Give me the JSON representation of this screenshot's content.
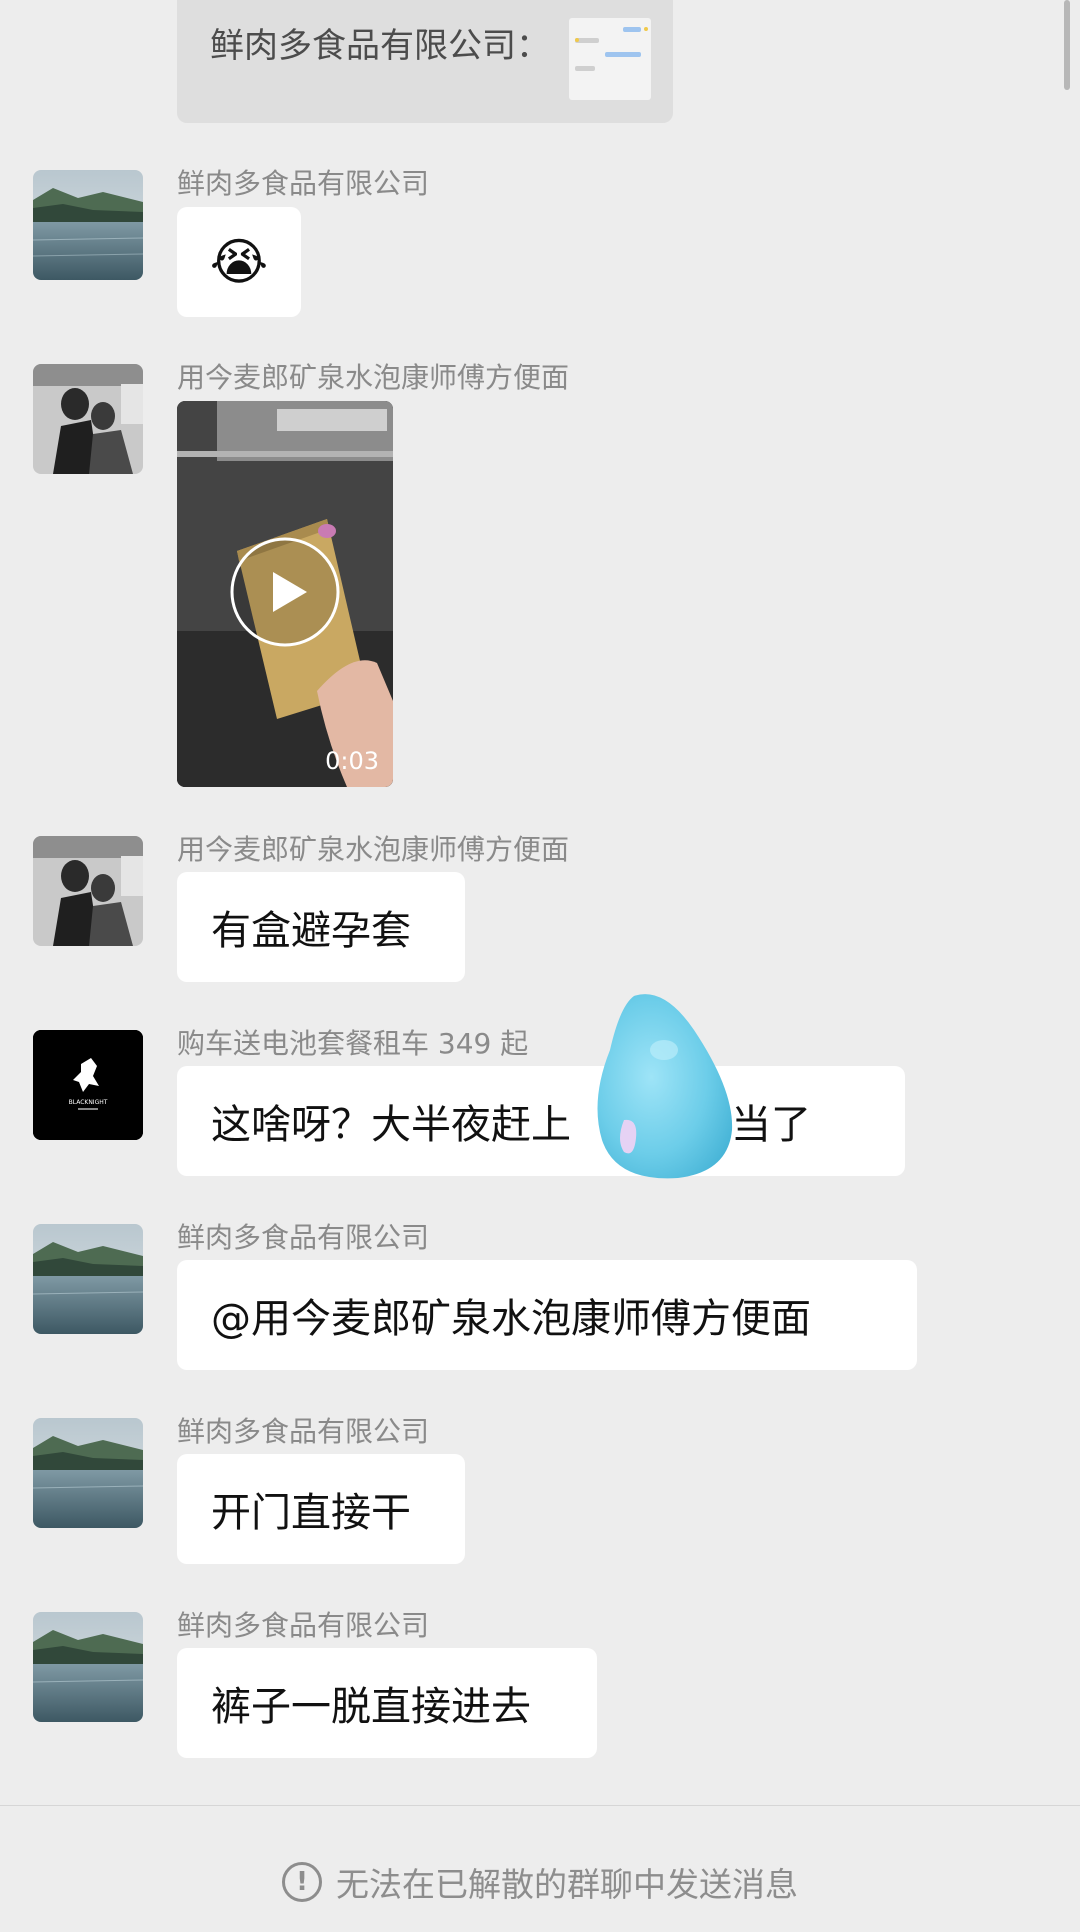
{
  "quote": {
    "text": "鲜肉多食品有限公司："
  },
  "messages": [
    {
      "sender": "鲜肉多食品有限公司",
      "emoji": "😭"
    },
    {
      "sender": "用今麦郎矿泉水泡康师傅方便面",
      "video_duration": "0:03"
    },
    {
      "sender": "用今麦郎矿泉水泡康师傅方便面",
      "text": "有盒避孕套"
    },
    {
      "sender": "购车送电池套餐租车 349 起",
      "text": "这啥呀？大半夜赶上",
      "text_tail": "勾当了"
    },
    {
      "sender": "鲜肉多食品有限公司",
      "text": "@用今麦郎矿泉水泡康师傅方便面"
    },
    {
      "sender": "鲜肉多食品有限公司",
      "text": "开门直接干"
    },
    {
      "sender": "鲜肉多食品有限公司",
      "text": "裤子一脱直接进去"
    }
  ],
  "avatar_logo_text": "BLACKNIGHT",
  "footer": {
    "icon": "exclamation-circle-icon",
    "notice": "无法在已解散的群聊中发送消息"
  },
  "colors": {
    "background": "#ededed",
    "bubble": "#ffffff",
    "sender_text": "#8a8a8a"
  }
}
